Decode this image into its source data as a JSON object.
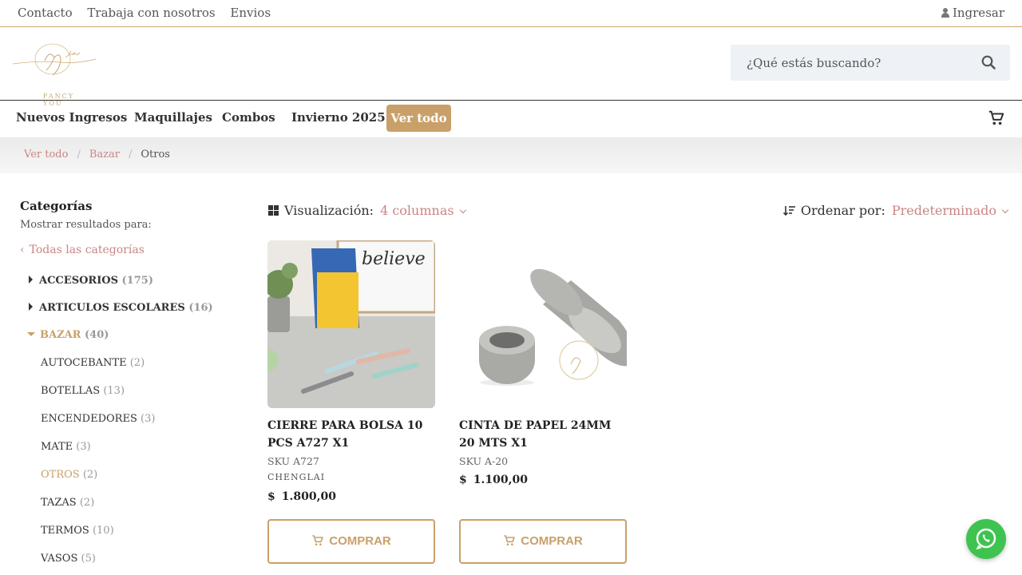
{
  "topbar": {
    "links": [
      "Contacto",
      "Trabaja con nosotros",
      "Envios"
    ],
    "login": "Ingresar"
  },
  "logo": {
    "text": "FANCY YOU"
  },
  "search": {
    "placeholder": "¿Qué estás buscando?"
  },
  "nav": {
    "items": [
      "Nuevos Ingresos",
      "Maquillajes",
      "Combos",
      "Invierno 2025"
    ],
    "highlight": "Ver todo",
    "accent": "#c9a06a"
  },
  "breadcrumb": {
    "items": [
      "Ver todo",
      "Bazar"
    ],
    "current": "Otros"
  },
  "sidebar": {
    "title": "Categorías",
    "subtitle": "Mostrar resultados para:",
    "all": "Todas las categorías",
    "top_categories": [
      {
        "name": "ACCESORIOS",
        "count": "(175)"
      },
      {
        "name": "ARTICULOS ESCOLARES",
        "count": "(16)"
      },
      {
        "name": "BAZAR",
        "count": "(40)"
      }
    ],
    "sub_categories": [
      {
        "name": "AUTOCEBANTE",
        "count": "(2)"
      },
      {
        "name": "BOTELLAS",
        "count": "(13)"
      },
      {
        "name": "ENCENDEDORES",
        "count": "(3)"
      },
      {
        "name": "MATE",
        "count": "(3)"
      },
      {
        "name": "OTROS",
        "count": "(2)"
      },
      {
        "name": "TAZAS",
        "count": "(2)"
      },
      {
        "name": "TERMOS",
        "count": "(10)"
      },
      {
        "name": "VASOS",
        "count": "(5)"
      }
    ]
  },
  "toolbar": {
    "viz_label": "Visualización:",
    "viz_value": "4 columnas",
    "order_label": "Ordenar por:",
    "order_value": "Predeterminado"
  },
  "products": [
    {
      "name": "CIERRE PARA BOLSA 10 PCS A727 X1",
      "sku": "SKU A727",
      "brand": "CHENGLAI",
      "currency": "$",
      "price": "1.800,00",
      "buy": "COMPRAR",
      "image_text": "believe"
    },
    {
      "name": "CINTA DE PAPEL 24MM 20 MTS X1",
      "sku": "SKU A-20",
      "brand": "",
      "currency": "$",
      "price": "1.100,00",
      "buy": "COMPRAR"
    }
  ],
  "colors": {
    "link": "#c98585",
    "whatsapp": "#3fc350"
  }
}
